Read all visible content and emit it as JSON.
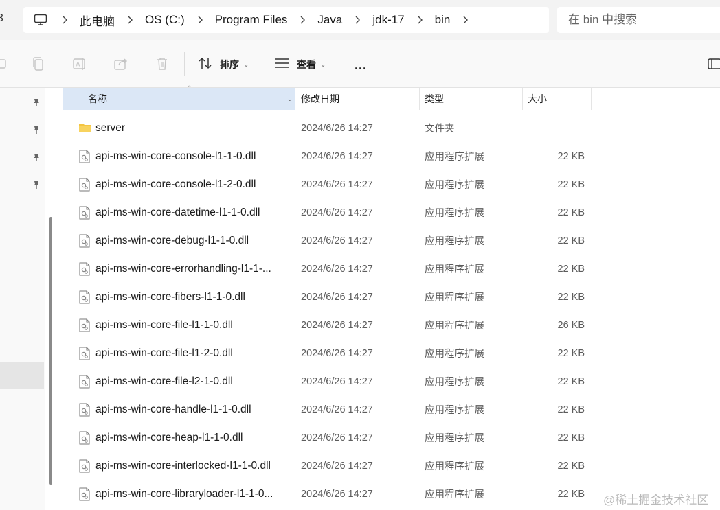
{
  "address_bar": {
    "crumbs": [
      "此电脑",
      "OS (C:)",
      "Program Files",
      "Java",
      "jdk-17",
      "bin"
    ],
    "left_clip": "3"
  },
  "search": {
    "placeholder": "在 bin 中搜索"
  },
  "toolbar": {
    "sort_label": "排序",
    "view_label": "查看",
    "more_label": "..."
  },
  "columns": {
    "name": "名称",
    "date": "修改日期",
    "type": "类型",
    "size": "大小"
  },
  "files": [
    {
      "name": "server",
      "date": "2024/6/26 14:27",
      "type": "文件夹",
      "size": "",
      "kind": "folder"
    },
    {
      "name": "api-ms-win-core-console-l1-1-0.dll",
      "date": "2024/6/26 14:27",
      "type": "应用程序扩展",
      "size": "22 KB",
      "kind": "dll"
    },
    {
      "name": "api-ms-win-core-console-l1-2-0.dll",
      "date": "2024/6/26 14:27",
      "type": "应用程序扩展",
      "size": "22 KB",
      "kind": "dll"
    },
    {
      "name": "api-ms-win-core-datetime-l1-1-0.dll",
      "date": "2024/6/26 14:27",
      "type": "应用程序扩展",
      "size": "22 KB",
      "kind": "dll"
    },
    {
      "name": "api-ms-win-core-debug-l1-1-0.dll",
      "date": "2024/6/26 14:27",
      "type": "应用程序扩展",
      "size": "22 KB",
      "kind": "dll"
    },
    {
      "name": "api-ms-win-core-errorhandling-l1-1-...",
      "date": "2024/6/26 14:27",
      "type": "应用程序扩展",
      "size": "22 KB",
      "kind": "dll"
    },
    {
      "name": "api-ms-win-core-fibers-l1-1-0.dll",
      "date": "2024/6/26 14:27",
      "type": "应用程序扩展",
      "size": "22 KB",
      "kind": "dll"
    },
    {
      "name": "api-ms-win-core-file-l1-1-0.dll",
      "date": "2024/6/26 14:27",
      "type": "应用程序扩展",
      "size": "26 KB",
      "kind": "dll"
    },
    {
      "name": "api-ms-win-core-file-l1-2-0.dll",
      "date": "2024/6/26 14:27",
      "type": "应用程序扩展",
      "size": "22 KB",
      "kind": "dll"
    },
    {
      "name": "api-ms-win-core-file-l2-1-0.dll",
      "date": "2024/6/26 14:27",
      "type": "应用程序扩展",
      "size": "22 KB",
      "kind": "dll"
    },
    {
      "name": "api-ms-win-core-handle-l1-1-0.dll",
      "date": "2024/6/26 14:27",
      "type": "应用程序扩展",
      "size": "22 KB",
      "kind": "dll"
    },
    {
      "name": "api-ms-win-core-heap-l1-1-0.dll",
      "date": "2024/6/26 14:27",
      "type": "应用程序扩展",
      "size": "22 KB",
      "kind": "dll"
    },
    {
      "name": "api-ms-win-core-interlocked-l1-1-0.dll",
      "date": "2024/6/26 14:27",
      "type": "应用程序扩展",
      "size": "22 KB",
      "kind": "dll"
    },
    {
      "name": "api-ms-win-core-libraryloader-l1-1-0...",
      "date": "2024/6/26 14:27",
      "type": "应用程序扩展",
      "size": "22 KB",
      "kind": "dll"
    }
  ],
  "watermark": "@稀土掘金技术社区",
  "colors": {
    "header_selected": "#dbe7f6",
    "folder": "#f4c542",
    "toolbar_bg": "#f9f9f9",
    "address_bg": "#f3f3f3"
  }
}
